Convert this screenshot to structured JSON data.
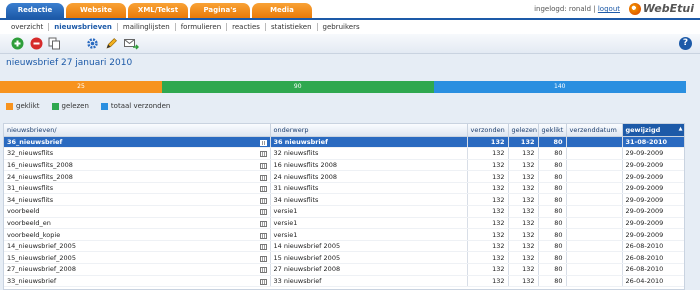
{
  "tabs": [
    "Redactie",
    "Website",
    "XML/Tekst",
    "Pagina's",
    "Media"
  ],
  "user": {
    "logged_in_text": "ingelogd: ronald",
    "separator": "|",
    "logout": "logout"
  },
  "logo": {
    "text": "WebEtui"
  },
  "subnav": [
    "overzicht",
    "nieuwsbrieven",
    "mailinglijsten",
    "formulieren",
    "reacties",
    "statistieken",
    "gebruikers"
  ],
  "subnav_active": "nieuwsbrieven",
  "toolbar": {
    "help_label": "?"
  },
  "page_title": "nieuwsbrief 27 januari 2010",
  "stats": {
    "geklikt": "25",
    "gelezen": "90",
    "totaal": "140",
    "geklikt_value": 25,
    "gelezen_value": 90,
    "totaal_value": 140,
    "colors": {
      "geklikt": "#f7931e",
      "gelezen": "#2fa84f",
      "totaal": "#2a8fe0"
    }
  },
  "legend": [
    "geklikt",
    "gelezen",
    "totaal verzonden"
  ],
  "table": {
    "columns": [
      "nieuwsbrieven/",
      "onderwerp",
      "verzonden",
      "gelezen",
      "geklikt",
      "verzenddatum",
      "gewijzigd"
    ],
    "sorted_column": "gewijzigd",
    "rows": [
      [
        "36_nieuwsbrief",
        "36 nieuwsbrief",
        "132",
        "132",
        "80",
        "",
        "31-08-2010"
      ],
      [
        "32_nieuwsflits",
        "32 nieuwsflits",
        "132",
        "132",
        "80",
        "",
        "29-09-2009"
      ],
      [
        "16_nieuwsflits_2008",
        "16 nieuwsflits 2008",
        "132",
        "132",
        "80",
        "",
        "29-09-2009"
      ],
      [
        "24_nieuwsflits_2008",
        "24 nieuwsflits 2008",
        "132",
        "132",
        "80",
        "",
        "29-09-2009"
      ],
      [
        "31_nieuwsflits",
        "31 nieuwsflits",
        "132",
        "132",
        "80",
        "",
        "29-09-2009"
      ],
      [
        "34_nieuwsflits",
        "34 nieuwsflits",
        "132",
        "132",
        "80",
        "",
        "29-09-2009"
      ],
      [
        "voorbeeld",
        "versie1",
        "132",
        "132",
        "80",
        "",
        "29-09-2009"
      ],
      [
        "voorbeeld_en",
        "versie1",
        "132",
        "132",
        "80",
        "",
        "29-09-2009"
      ],
      [
        "voorbeeld_kopie",
        "versie1",
        "132",
        "132",
        "80",
        "",
        "29-09-2009"
      ],
      [
        "14_nieuwsbrief_2005",
        "14 nieuwsbrief 2005",
        "132",
        "132",
        "80",
        "",
        "26-08-2010"
      ],
      [
        "15_nieuwsbrief_2005",
        "15 nieuwsbrief 2005",
        "132",
        "132",
        "80",
        "",
        "26-08-2010"
      ],
      [
        "27_nieuwsbrief_2008",
        "27 nieuwsbrief 2008",
        "132",
        "132",
        "80",
        "",
        "26-08-2010"
      ],
      [
        "33_nieuwsbrief",
        "33 nieuwsbrief",
        "132",
        "132",
        "80",
        "",
        "26-04-2010"
      ]
    ]
  }
}
